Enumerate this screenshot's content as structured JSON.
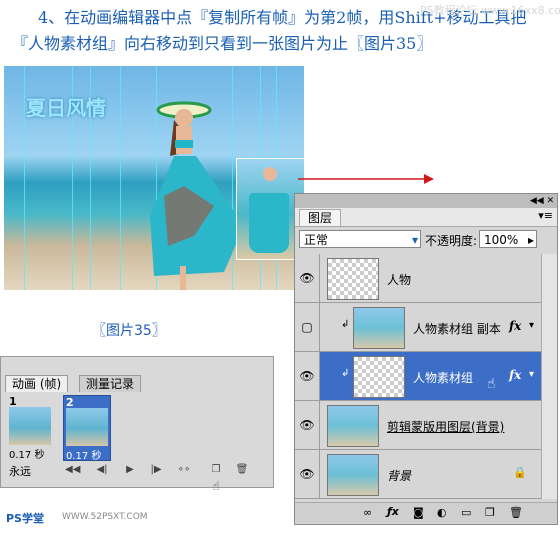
{
  "instruction": {
    "line1": "4、在动画编辑器中点『复制所有帧』为第2帧，用Shift+移动工具把",
    "line2": "『人物素材组』向右移动到只看到一张图片为止〖图片35〗"
  },
  "watermark": "PS教程论坛 www.16xx8.com",
  "figure_caption": "〖图片35〗",
  "photo": {
    "overlay_title": "夏日风情"
  },
  "animation_panel": {
    "tabs": [
      "动画 (帧)",
      "测量记录"
    ],
    "frames": [
      {
        "number": "1",
        "duration": "0.17 秒"
      },
      {
        "number": "2",
        "duration": "0.17 秒"
      }
    ],
    "loop_option": "永远"
  },
  "layers_panel": {
    "tab": "图层",
    "blend_mode": "正常",
    "opacity_label": "不透明度:",
    "opacity_value": "100%",
    "layers": [
      {
        "name": "人物",
        "visible": true,
        "selected": false
      },
      {
        "name": "人物素材组 副本",
        "visible": false,
        "selected": false,
        "fx": "fx"
      },
      {
        "name": "人物素材组",
        "visible": true,
        "selected": true,
        "fx": "fx"
      },
      {
        "name": "剪辑蒙版用图层(背景)",
        "visible": true,
        "selected": false
      },
      {
        "name": "背景",
        "visible": true,
        "selected": false
      }
    ]
  },
  "footer_logo": {
    "left": "PS学堂",
    "right": "WWW.52PSXT.COM"
  }
}
